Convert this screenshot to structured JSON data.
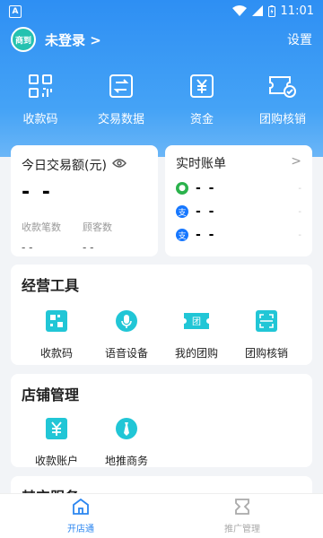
{
  "status_bar": {
    "app_badge": "A",
    "time": "11:01"
  },
  "header": {
    "logo_text": "商到",
    "login_label": "未登录 >",
    "settings_label": "设置"
  },
  "quick_actions": [
    {
      "label": "收款码",
      "icon": "qr-grid-icon"
    },
    {
      "label": "交易数据",
      "icon": "exchange-icon"
    },
    {
      "label": "资金",
      "icon": "yuan-icon"
    },
    {
      "label": "团购核销",
      "icon": "coupon-verify-icon"
    }
  ],
  "stats": {
    "title": "今日交易额(元)",
    "value": "- -",
    "count_label": "收款笔数",
    "count_value": "- -",
    "customers_label": "顾客数",
    "customers_value": "- -"
  },
  "ledger": {
    "title": "实时账单",
    "chevron": ">",
    "rows": [
      {
        "value": "- -",
        "tail": "-",
        "icon": "wechat-icon",
        "color": "#2bb24c"
      },
      {
        "value": "- -",
        "tail": "-",
        "icon": "alipay-icon",
        "color": "#1677ff"
      },
      {
        "value": "- -",
        "tail": "-",
        "icon": "alipay-icon",
        "color": "#1677ff"
      }
    ]
  },
  "tools": {
    "title": "经营工具",
    "items": [
      {
        "label": "收款码",
        "icon": "qr-code-icon"
      },
      {
        "label": "语音设备",
        "icon": "speaker-icon"
      },
      {
        "label": "我的团购",
        "icon": "group-ticket-icon"
      },
      {
        "label": "团购核销",
        "icon": "scan-icon"
      }
    ]
  },
  "shop": {
    "title": "店铺管理",
    "items": [
      {
        "label": "收款账户",
        "icon": "account-icon"
      },
      {
        "label": "地推商务",
        "icon": "tie-icon"
      }
    ]
  },
  "other": {
    "title": "其它服务"
  },
  "tabbar": [
    {
      "label": "开店通",
      "icon": "home-icon",
      "active": true
    },
    {
      "label": "推广管理",
      "icon": "promo-icon",
      "active": false
    }
  ],
  "colors": {
    "primary": "#2e8ff3",
    "accent": "#2b86f0",
    "teal": "#21c6d6"
  }
}
